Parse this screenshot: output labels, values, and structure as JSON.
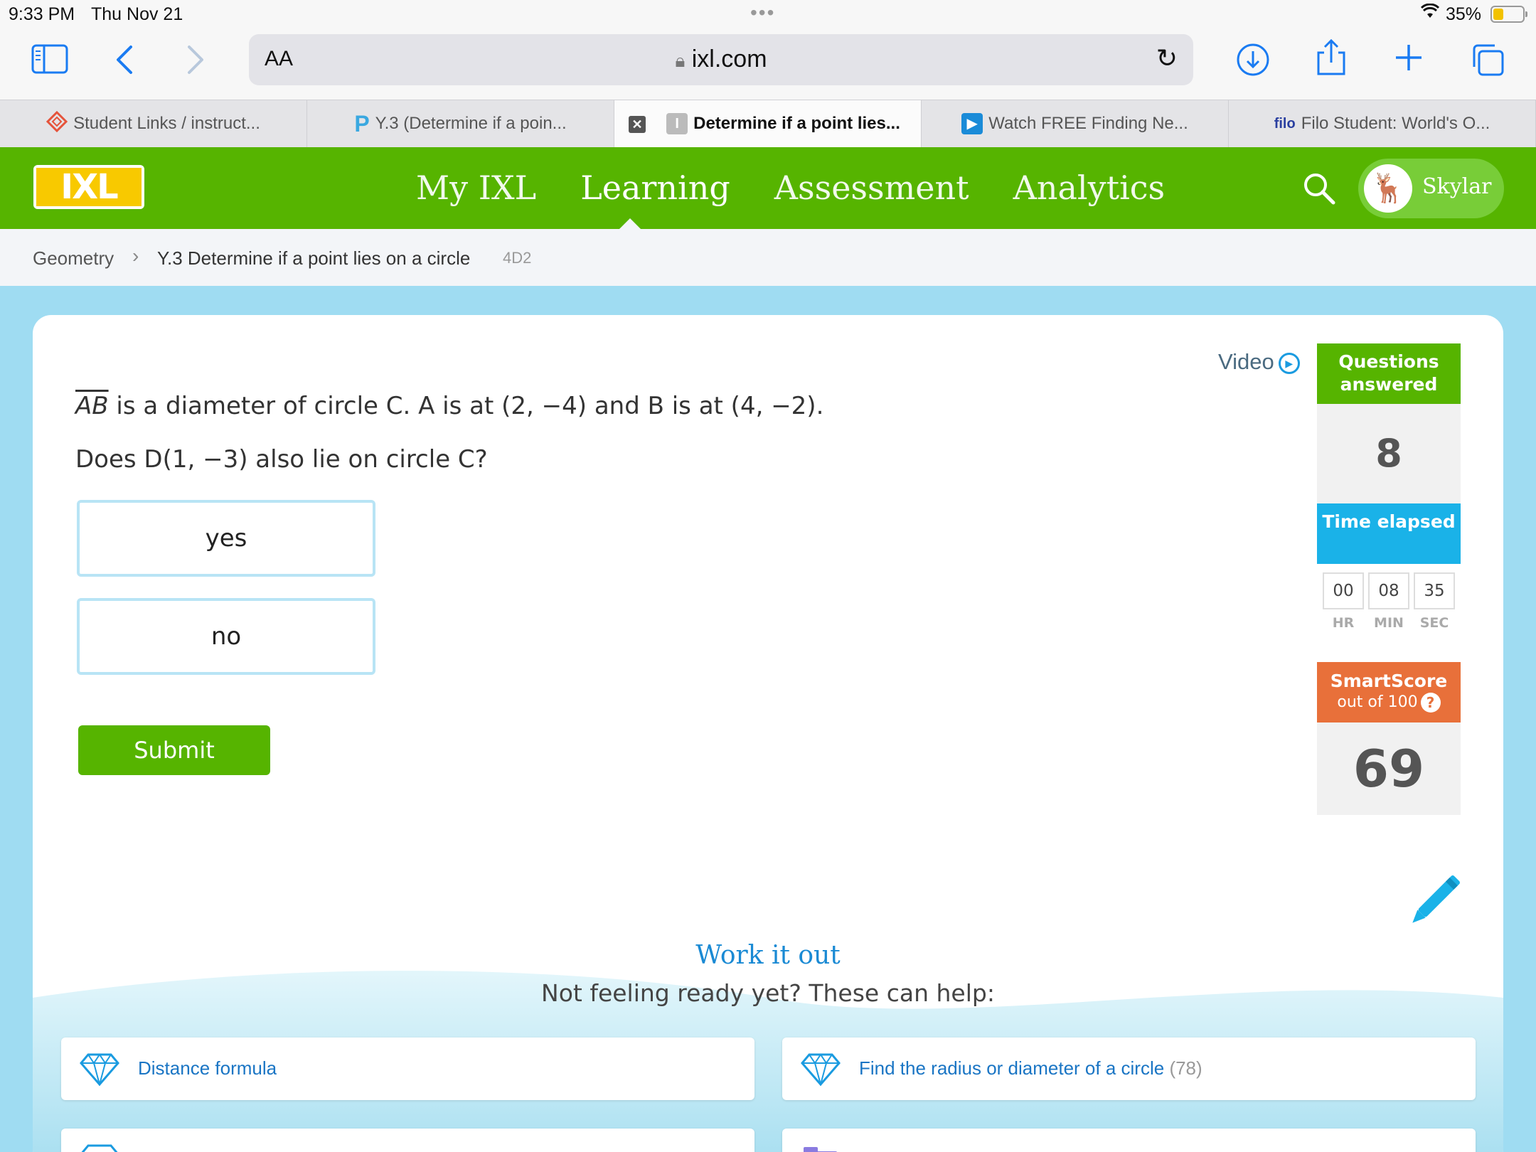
{
  "status": {
    "time": "9:33 PM",
    "date": "Thu Nov 21",
    "battery": "35%",
    "battery_level": 0.35
  },
  "browser": {
    "aa_label": "AA",
    "url": "ixl.com"
  },
  "tabs": [
    {
      "title": "Student Links / instruct..."
    },
    {
      "title": "Y.3 (Determine if a poin..."
    },
    {
      "title": "Determine if a point lies..."
    },
    {
      "title": "Watch FREE Finding Ne..."
    },
    {
      "title": "Filo Student: World's O...",
      "favicon_text": "filo"
    }
  ],
  "nav": {
    "items": [
      "My IXL",
      "Learning",
      "Assessment",
      "Analytics"
    ],
    "active": "Learning",
    "user": "Skylar",
    "brand_color": "#56b400"
  },
  "breadcrumb": {
    "subject": "Geometry",
    "skill": "Y.3 Determine if a point lies on a circle",
    "code": "4D2"
  },
  "question": {
    "segment": "AB",
    "line1_rest": " is a diameter of circle C. A is at (2, −4) and B is at (4, −2).",
    "line2": "Does D(1, −3) also lie on circle C?",
    "choices": [
      "yes",
      "no"
    ],
    "submit_label": "Submit",
    "video_label": "Video"
  },
  "sidebar": {
    "questions_label": "Questions answered",
    "questions_answered": "8",
    "time_label": "Time elapsed",
    "hr": "00",
    "min": "08",
    "sec": "35",
    "hr_label": "HR",
    "min_label": "MIN",
    "sec_label": "SEC",
    "smartscore_label": "SmartScore",
    "smartscore_sub": "out of 100",
    "smartscore": "69"
  },
  "help": {
    "title": "Work it out",
    "subtitle": "Not feeling ready yet? These can help:",
    "items": [
      {
        "label": "Distance formula",
        "count": ""
      },
      {
        "label": "Find the radius or diameter of a circle",
        "count": "(78)"
      }
    ]
  }
}
